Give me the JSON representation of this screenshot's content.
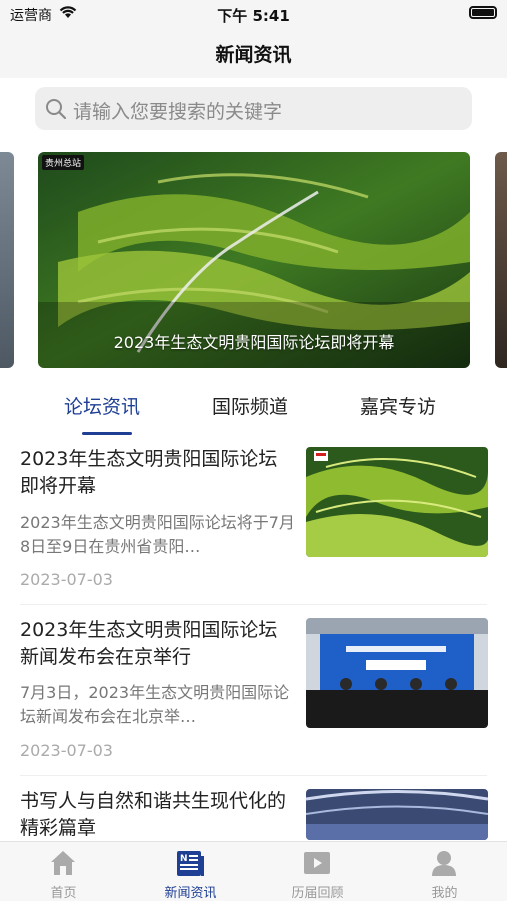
{
  "status_bar": {
    "carrier": "运营商",
    "time": "下午 5:41"
  },
  "nav": {
    "title": "新闻资讯"
  },
  "search": {
    "placeholder": "请输入您要搜索的关键字",
    "icon": "search-icon"
  },
  "banner": {
    "caption": "2023年生态文明贵阳国际论坛即将开幕",
    "badge": "贵州总站"
  },
  "tabs": [
    {
      "label": "论坛资讯",
      "active": true
    },
    {
      "label": "国际频道",
      "active": false
    },
    {
      "label": "嘉宾专访",
      "active": false
    }
  ],
  "news": [
    {
      "headline": "2023年生态文明贵阳国际论坛即将开幕",
      "summary": "2023年生态文明贵阳国际论坛将于7月8日至9日在贵州省贵阳…",
      "date": "2023-07-03"
    },
    {
      "headline": "2023年生态文明贵阳国际论坛新闻发布会在京举行",
      "summary": "7月3日，2023年生态文明贵阳国际论坛新闻发布会在北京举…",
      "date": "2023-07-03"
    },
    {
      "headline": "书写人与自然和谐共生现代化的精彩篇章",
      "summary": "",
      "date": ""
    }
  ],
  "tab_bar": [
    {
      "label": "首页",
      "icon": "home-icon",
      "active": false
    },
    {
      "label": "新闻资讯",
      "icon": "news-icon",
      "active": true
    },
    {
      "label": "历届回顾",
      "icon": "play-video-icon",
      "active": false
    },
    {
      "label": "我的",
      "icon": "person-icon",
      "active": false
    }
  ],
  "colors": {
    "accent": "#1f3f95",
    "inactive": "#999999"
  }
}
